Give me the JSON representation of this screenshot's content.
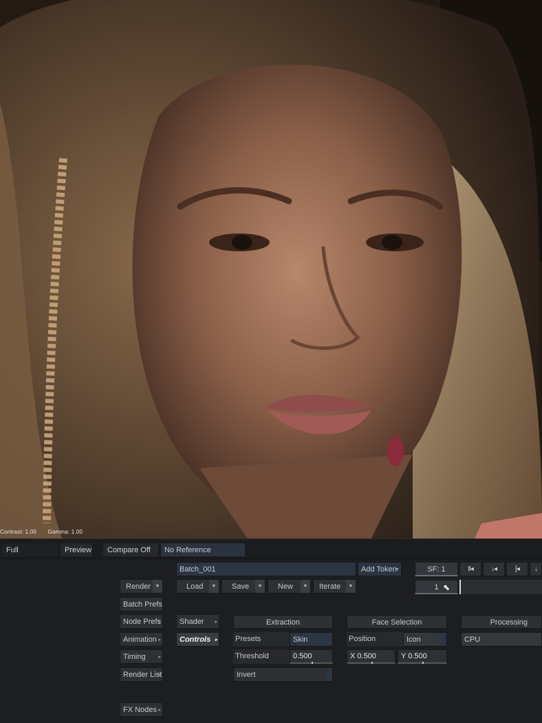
{
  "viewer": {
    "contrast": "Contrast: 1.00",
    "gamma": "Gamma: 1.00"
  },
  "toolbar": {
    "full_resolution": "Full Resolution",
    "preview": "Preview",
    "compare": "Compare Off",
    "reference": "No Reference"
  },
  "batch": {
    "name": "Batch_001",
    "add_token": "Add Token",
    "load": "Load",
    "save": "Save",
    "new": "New",
    "iterate": "Iterate"
  },
  "left_menu": {
    "render": "Render",
    "batch_prefs": "Batch Prefs",
    "node_prefs": "Node Prefs",
    "animation": "Animation",
    "timing": "Timing",
    "render_list": "Render List",
    "fx_nodes": "FX Nodes"
  },
  "node_tabs": {
    "shader": "Shader",
    "controls": "Controls"
  },
  "extraction": {
    "header": "Extraction",
    "presets_label": "Presets",
    "presets_value": "Skin",
    "threshold_label": "Threshold",
    "threshold_value": "0.500",
    "invert": "Invert"
  },
  "face_selection": {
    "header": "Face Selection",
    "position_label": "Position",
    "position_value": "Icon",
    "x_value": "X 0.500",
    "y_value": "Y 0.500"
  },
  "processing": {
    "header": "Processing",
    "device": "CPU"
  },
  "transport": {
    "start_frame": "SF: 1",
    "current_frame": "1",
    "icons": [
      "pause-step-icon",
      "set-in-icon",
      "go-to-in-icon",
      "set-out-icon"
    ],
    "glyphs": [
      "II◂",
      "↓◂",
      "[◂",
      "↓"
    ]
  },
  "colors": {
    "panel_bg": "#1d1e20",
    "button_bg": "#2e3034",
    "field_blue": "#2b3544",
    "accent_text": "#c6c9ce"
  }
}
